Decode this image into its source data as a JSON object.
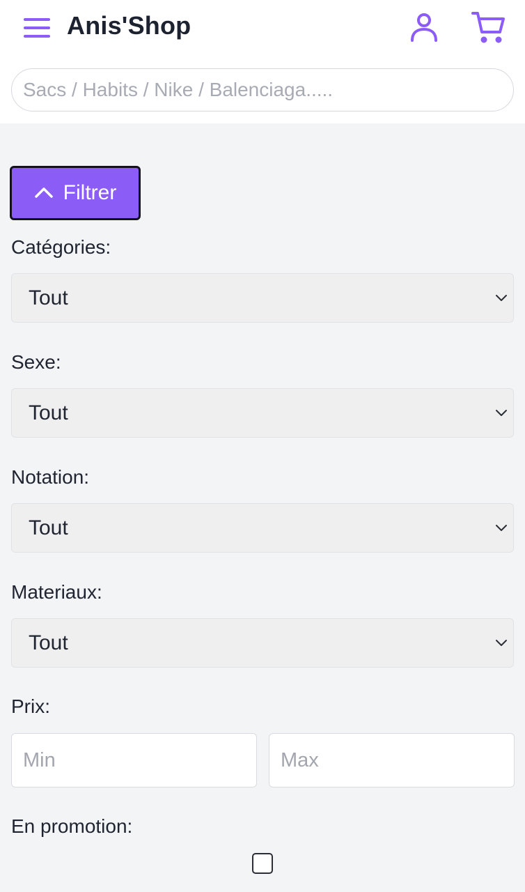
{
  "colors": {
    "accent": "#8b5cf6",
    "background": "#f3f4f6",
    "select_bg": "#efefef"
  },
  "header": {
    "brand": "Anis'Shop",
    "icons": [
      "menu-icon",
      "user-icon",
      "cart-icon"
    ],
    "search": {
      "placeholder": "Sacs / Habits / Nike / Balenciaga.....",
      "value": ""
    }
  },
  "filters": {
    "toggle_label": "Filtrer",
    "toggle_icon": "chevron-up-icon",
    "categories": {
      "label": "Catégories:",
      "value": "Tout"
    },
    "sexe": {
      "label": "Sexe:",
      "value": "Tout"
    },
    "notation": {
      "label": "Notation:",
      "value": "Tout"
    },
    "materiaux": {
      "label": "Materiaux:",
      "value": "Tout"
    },
    "prix": {
      "label": "Prix:",
      "min_placeholder": "Min",
      "max_placeholder": "Max"
    },
    "promotion": {
      "label": "En promotion:",
      "checked": false
    }
  }
}
